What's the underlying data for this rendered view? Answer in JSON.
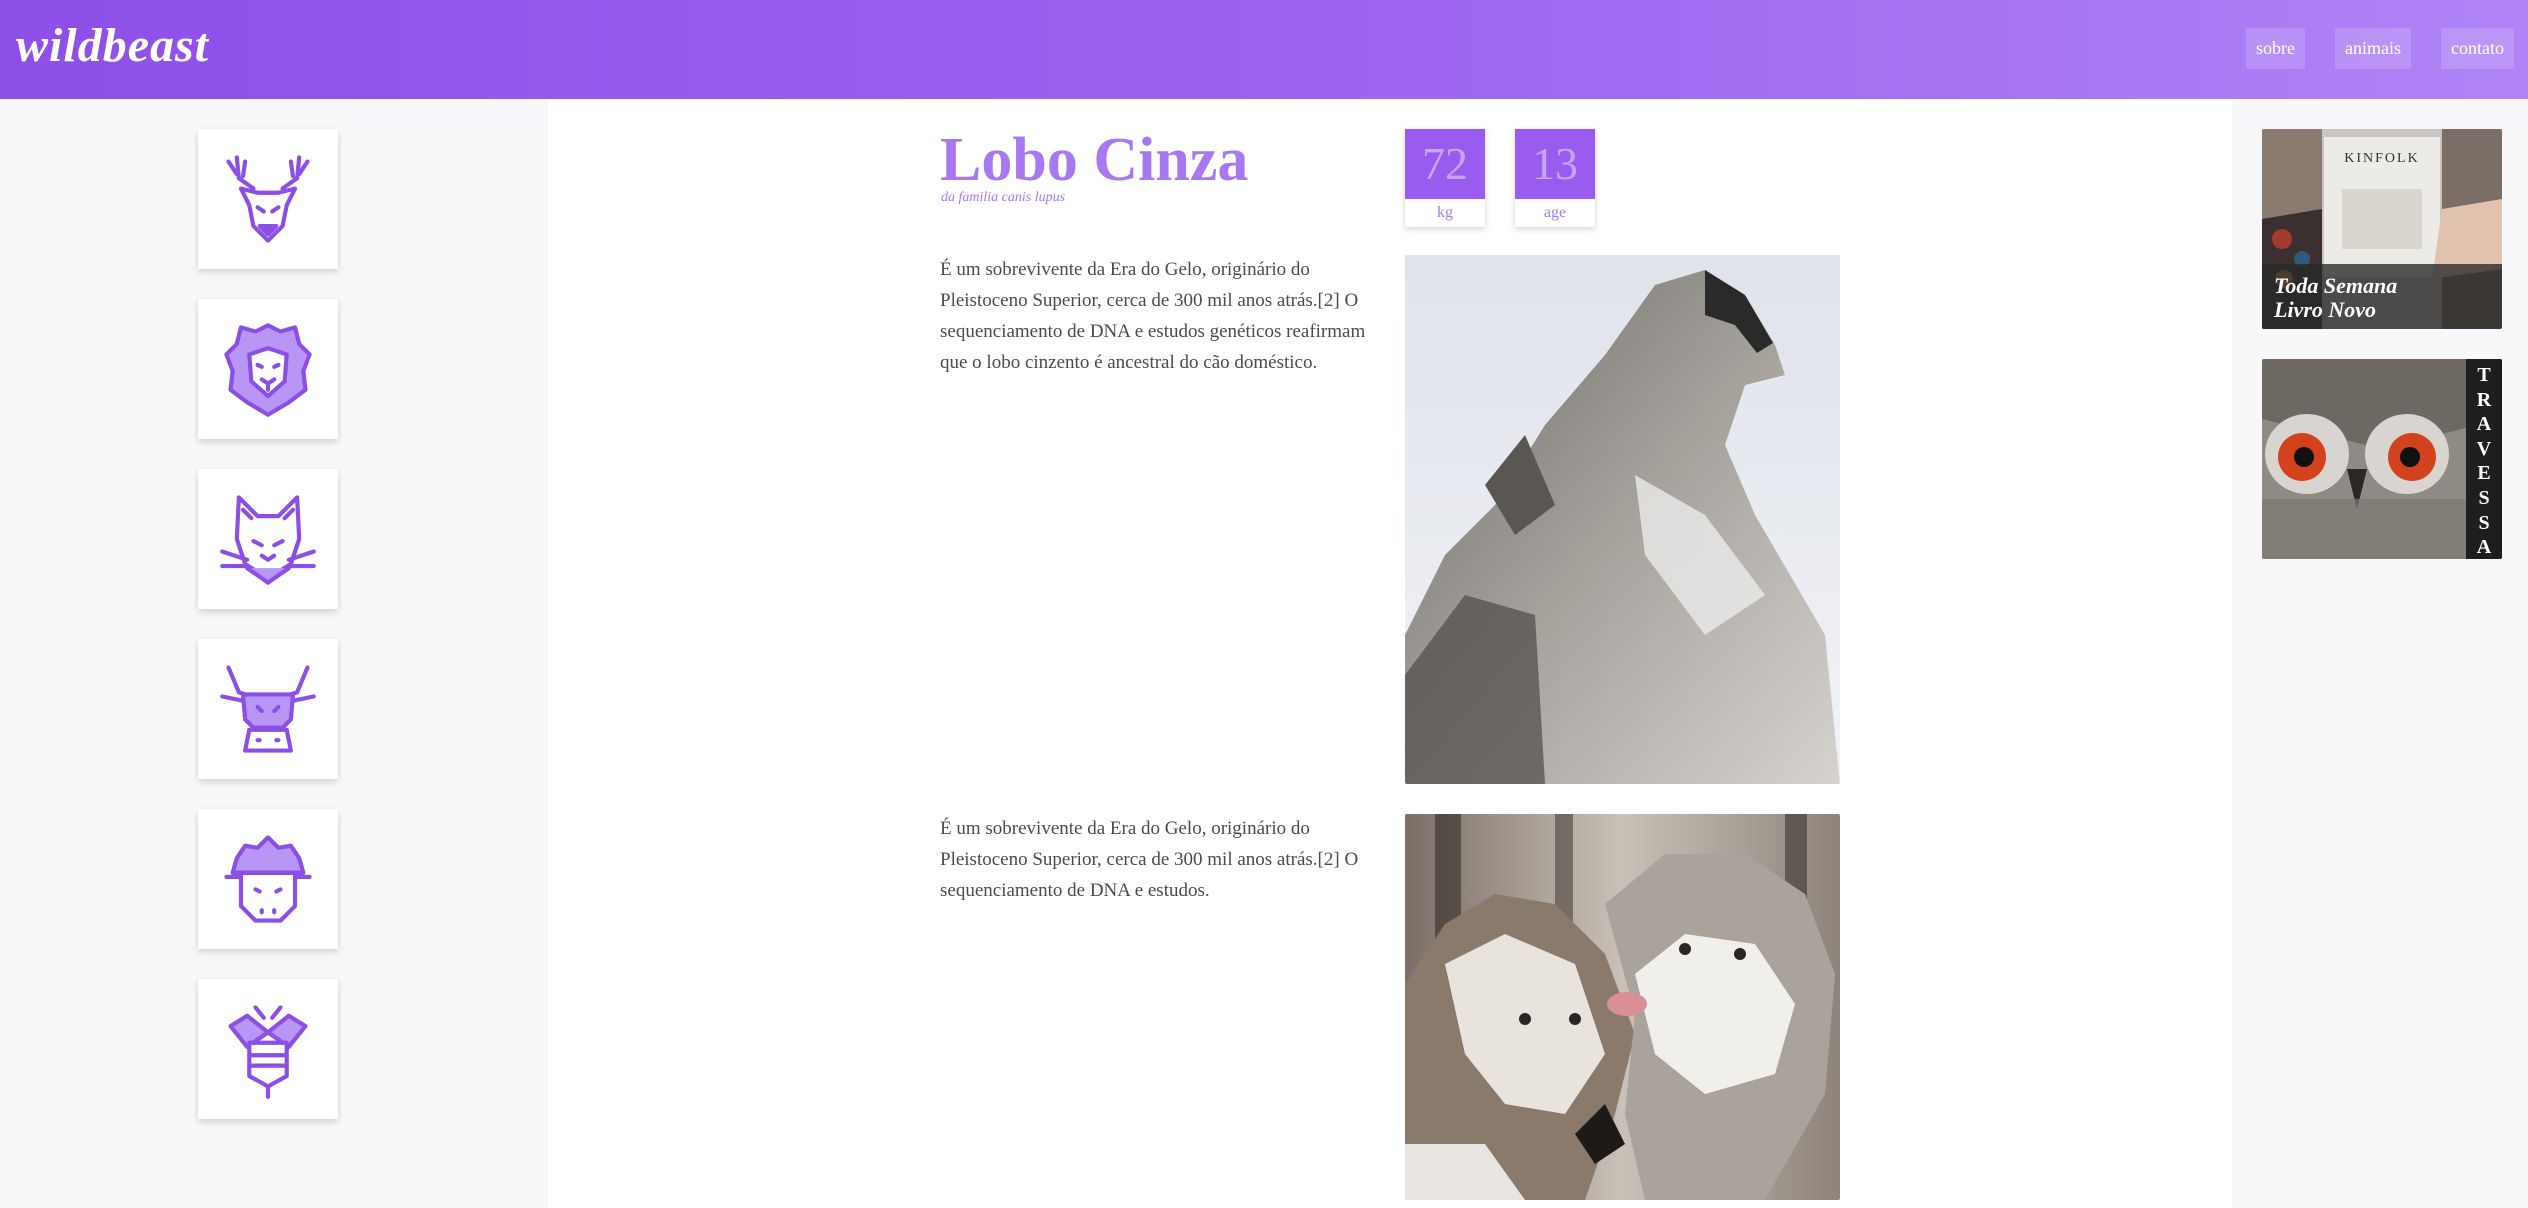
{
  "header": {
    "logo": "wildbeast",
    "nav": [
      "sobre",
      "animais",
      "contato"
    ]
  },
  "sidebar": {
    "animals": [
      "deer-icon",
      "lion-icon",
      "cat-icon",
      "bull-icon",
      "sheep-icon",
      "bee-icon"
    ]
  },
  "animal": {
    "name": "Lobo Cinza",
    "family": "da familia canis lupus",
    "stats": [
      {
        "value": "72",
        "label": "kg"
      },
      {
        "value": "13",
        "label": "age"
      }
    ],
    "paragraphs": [
      "É um sobrevivente da Era do Gelo, originário do Pleistoceno Superior, cerca de 300 mil anos atrás.[2] O sequenciamento de DNA e estudos genéticos reafirmam que o lobo cinzento é ancestral do cão doméstico.",
      "É um sobrevivente da Era do Gelo, originário do Pleistoceno Superior, cerca de 300 mil anos atrás.[2] O sequenciamento de DNA e estudos."
    ]
  },
  "ads": [
    {
      "brand": "KINFOLK",
      "caption_line1": "Toda Semana",
      "caption_line2": "Livro Novo"
    },
    {
      "vertical_text": "TRAVESSA"
    }
  ],
  "colors": {
    "accent": "#9a5cef",
    "title": "#a878f2",
    "header_start": "#8e4fe8",
    "header_end": "#b083f6"
  }
}
